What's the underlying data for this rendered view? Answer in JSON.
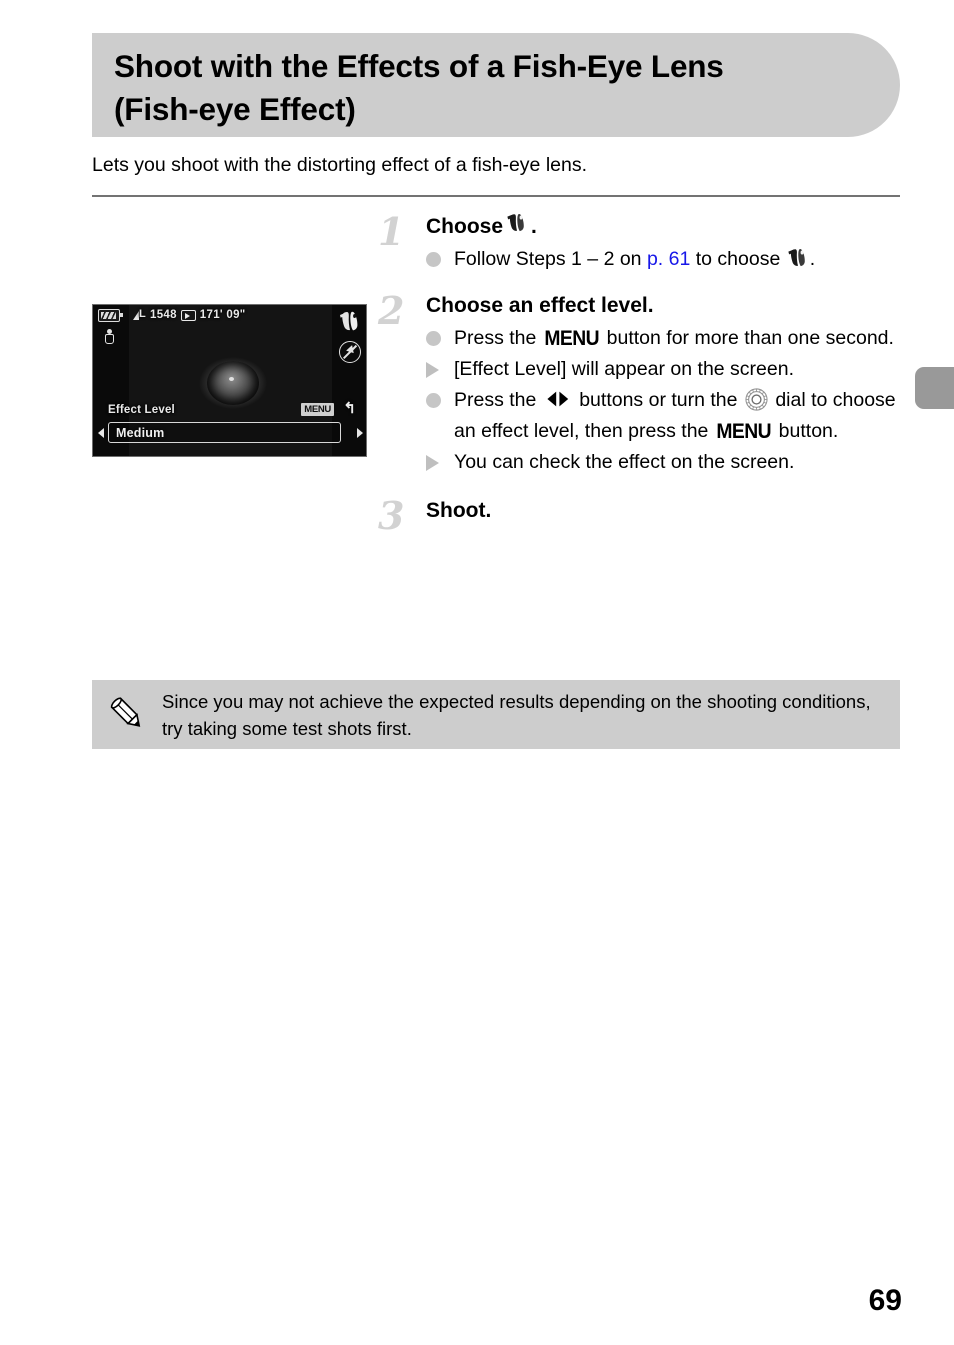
{
  "page": {
    "number": "69"
  },
  "title": {
    "text": "Shoot with the Effects of a Fish-Eye Lens\n(Fish-eye Effect)"
  },
  "intro": {
    "text": "Lets you shoot with the distorting effect of a fish-eye lens."
  },
  "figure": {
    "lcd": {
      "top_bar": {
        "quality_icon": "image-quality-large-icon",
        "shots_remaining": "1548",
        "movie_icon": "movie-mode-icon",
        "recording_time": "171' 09\""
      },
      "battery_icon": "battery-icon",
      "mode_icon": "camera-mode-icon",
      "fisheye_icon": "fish-eye-effect-icon",
      "flash_icon": "flash-off-icon",
      "effect_label": "Effect Level",
      "effect_value": "Medium",
      "menu_badge": "MENU",
      "return_glyph": "↰",
      "left_arrow": "left-arrow-icon",
      "right_arrow": "right-arrow-icon"
    }
  },
  "steps": [
    {
      "number": "1",
      "title_prefix": "Choose ",
      "title_icon": "fish-eye-effect-icon",
      "title_suffix": ".",
      "lines": [
        {
          "marker": "dot",
          "segments": [
            {
              "type": "text",
              "value": "Follow Steps 1 – 2 on "
            },
            {
              "type": "pageref",
              "value": "p. 61"
            },
            {
              "type": "text",
              "value": " to choose "
            },
            {
              "type": "icon",
              "value": "fish-eye-effect-icon"
            },
            {
              "type": "text",
              "value": "."
            }
          ]
        }
      ]
    },
    {
      "number": "2",
      "title_prefix": "Choose an effect level.",
      "title_icon": "",
      "title_suffix": "",
      "lines": [
        {
          "marker": "dot",
          "segments": [
            {
              "type": "text",
              "value": "Press the "
            },
            {
              "type": "menu",
              "value": "MENU"
            },
            {
              "type": "text",
              "value": " button for more than one second."
            }
          ]
        },
        {
          "marker": "triangle",
          "segments": [
            {
              "type": "text",
              "value": "[Effect Level] will appear on the screen."
            }
          ]
        },
        {
          "marker": "dot",
          "segments": [
            {
              "type": "text",
              "value": "Press the "
            },
            {
              "type": "icon",
              "value": "left-right-buttons-icon"
            },
            {
              "type": "text",
              "value": " buttons or turn the "
            },
            {
              "type": "icon",
              "value": "control-dial-icon"
            },
            {
              "type": "text",
              "value": " dial to choose an effect level, then press the "
            },
            {
              "type": "menu",
              "value": "MENU"
            },
            {
              "type": "text",
              "value": " button."
            }
          ]
        },
        {
          "marker": "triangle",
          "segments": [
            {
              "type": "text",
              "value": "You can check the effect on the screen."
            }
          ]
        }
      ]
    },
    {
      "number": "3",
      "title_prefix": "Shoot.",
      "title_icon": "",
      "title_suffix": "",
      "lines": []
    }
  ],
  "note": {
    "icon": "pencil-icon",
    "text": "Since you may not achieve the expected results depending on the shooting conditions, try taking some test shots first."
  },
  "colors": {
    "banner_gray": "#cdcdcd",
    "tab_gray": "#999999",
    "step_number_gray": "#d2d2d2",
    "bullet_gray": "#c6c6c6",
    "link_blue": "#1717e8",
    "divider_gray": "#737373"
  }
}
